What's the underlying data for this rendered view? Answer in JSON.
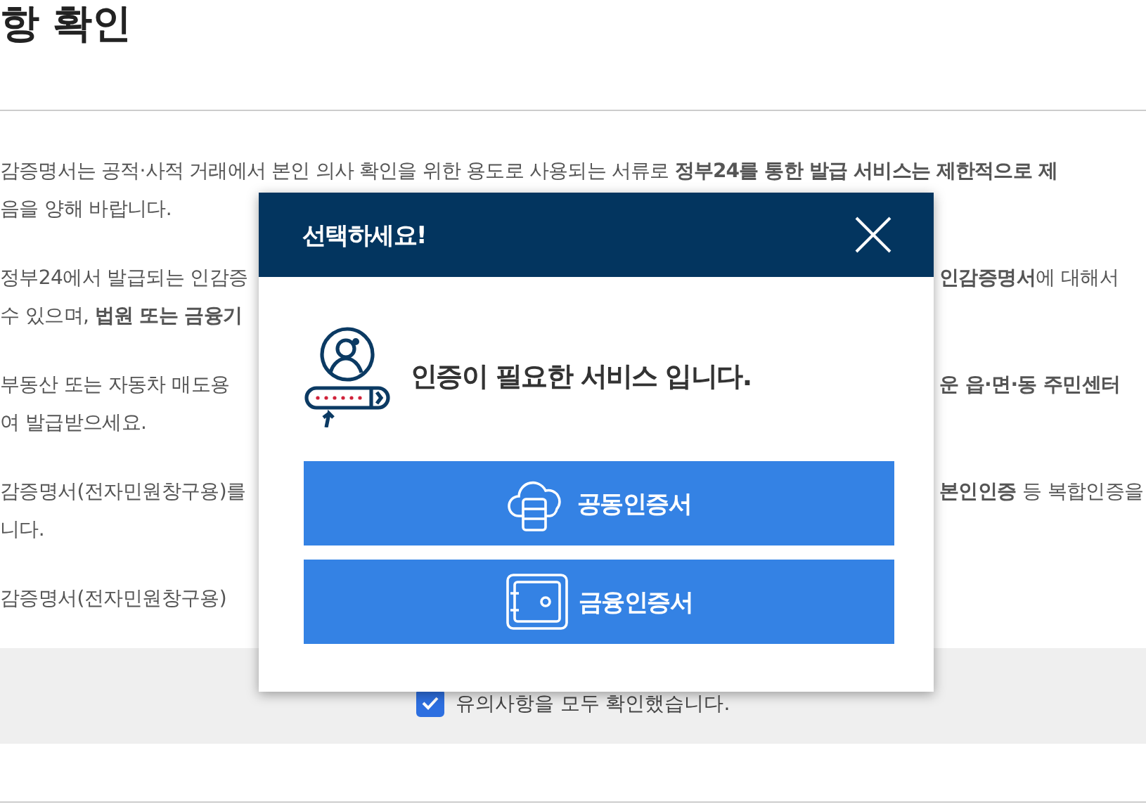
{
  "heading": "항 확인",
  "paragraphs": [
    {
      "lines": [
        {
          "text": "감증명서는 공적·사적 거래에서 본인 의사 확인을 위한 용도로 사용되는 서류로 **정부24를 통한 발급 서비스는 제한적으로 제**"
        },
        {
          "left": "음을 양해 바랍니다."
        }
      ]
    },
    {
      "lines": [
        {
          "left": "정부24에서 발급되는 인감증",
          "right": "**인감증명서**에 대해서"
        },
        {
          "left": "수 있으며, **법원 또는 금융기**"
        }
      ]
    },
    {
      "lines": [
        {
          "left": "부동산 또는 자동차 매도용",
          "right": "**운 읍·면·동 주민센터**"
        },
        {
          "left": "여 발급받으세요."
        }
      ]
    },
    {
      "lines": [
        {
          "left": "감증명서(전자민원창구용)를",
          "right": "**본인인증** 등 복합인증을"
        },
        {
          "left": "니다."
        }
      ]
    },
    {
      "lines": [
        {
          "left": "감증명서(전자민원창구용)"
        }
      ]
    }
  ],
  "agreement": {
    "label": "유의사항을 모두 확인했습니다.",
    "checked": true
  },
  "dialog": {
    "title": "선택하세요!",
    "message": "인증이 필요한 서비스 입니다.",
    "buttons": [
      {
        "label": "공동인증서",
        "kind": "cloud"
      },
      {
        "label": "금융인증서",
        "kind": "safe"
      }
    ]
  }
}
